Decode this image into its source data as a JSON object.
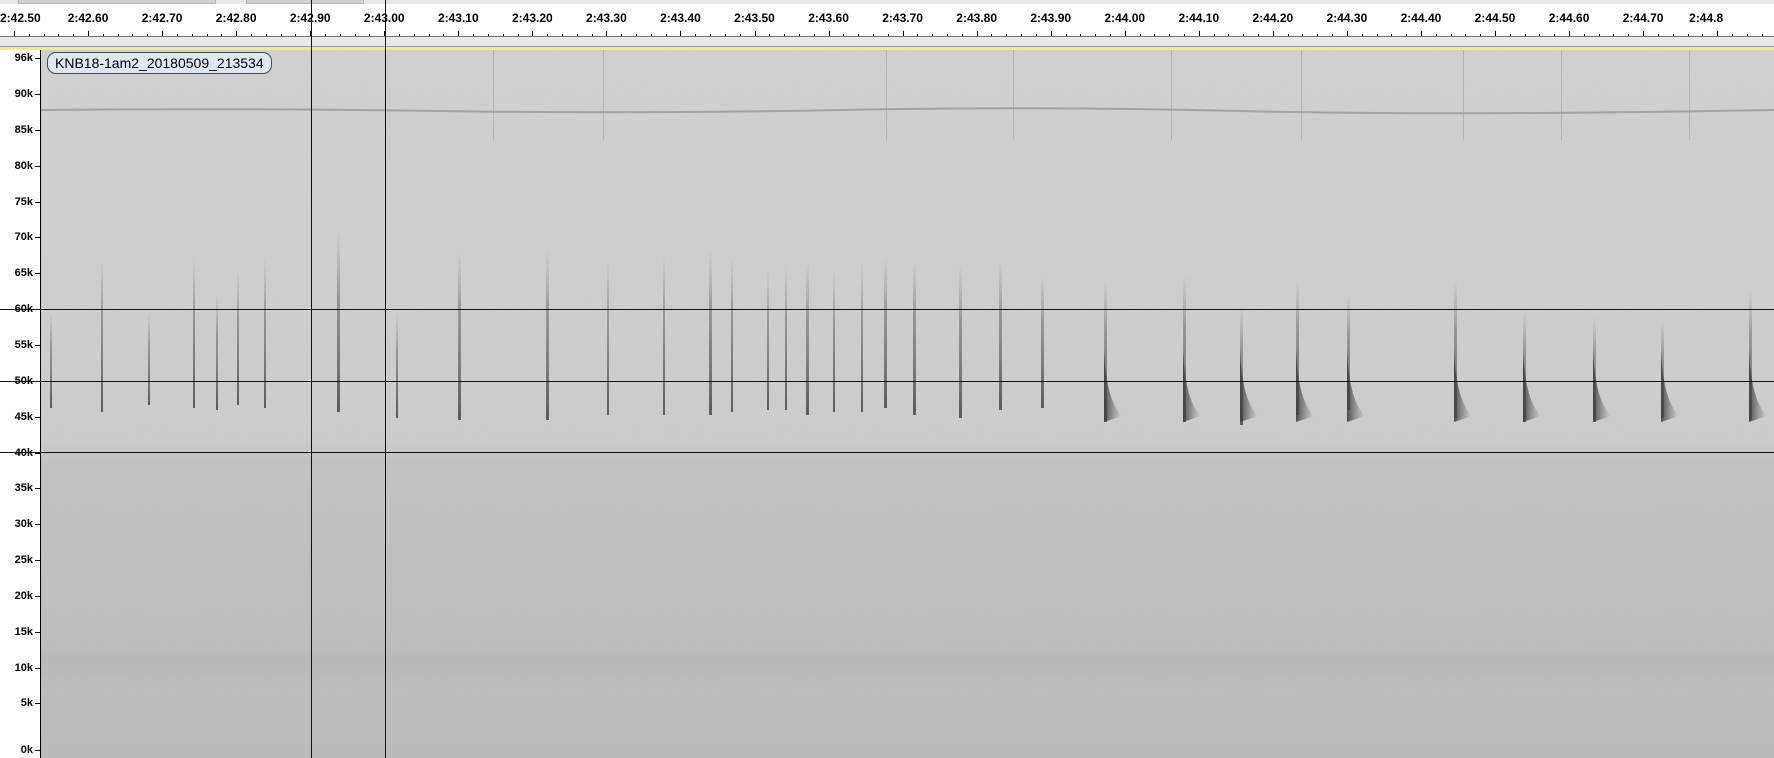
{
  "time_ruler": {
    "labels": [
      "2:42.50",
      "2:42.60",
      "2:42.70",
      "2:42.80",
      "2:42.90",
      "2:43.00",
      "2:43.10",
      "2:43.20",
      "2:43.30",
      "2:43.40",
      "2:43.50",
      "2:43.60",
      "2:43.70",
      "2:43.80",
      "2:43.90",
      "2:44.00",
      "2:44.10",
      "2:44.20",
      "2:44.30",
      "2:44.40",
      "2:44.50",
      "2:44.60",
      "2:44.70",
      "2:44.8"
    ]
  },
  "track": {
    "name": "KNB18-1am2_20180509_213534"
  },
  "frequency_axis": {
    "labels": [
      "96k",
      "90k",
      "85k",
      "80k",
      "75k",
      "70k",
      "65k",
      "60k",
      "55k",
      "50k",
      "45k",
      "40k",
      "35k",
      "30k",
      "25k",
      "20k",
      "15k",
      "10k",
      "5k",
      "0k"
    ]
  },
  "colors": {
    "spectrogram_background": "#c9c9c9",
    "selection_band": "#ece8a0",
    "track_name_fill": "#dfe7f3"
  }
}
